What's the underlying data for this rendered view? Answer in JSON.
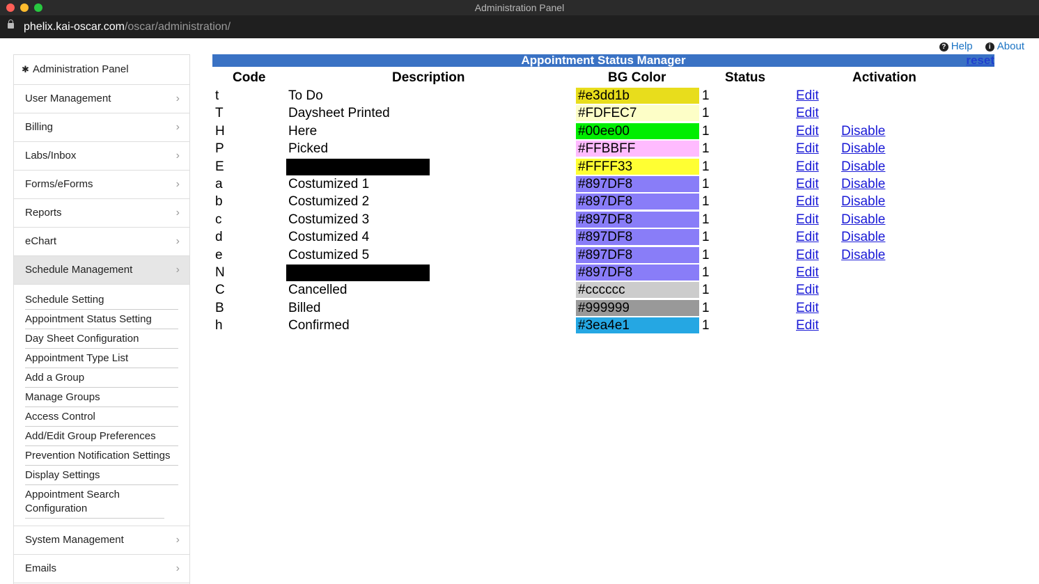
{
  "window": {
    "title": "Administration Panel"
  },
  "urlbar": {
    "host": "phelix.kai-oscar.com",
    "path": "/oscar/administration/"
  },
  "toplinks": {
    "help": "Help",
    "about": "About"
  },
  "sidebar": {
    "header": "Administration Panel",
    "sections": [
      "User Management",
      "Billing",
      "Labs/Inbox",
      "Forms/eForms",
      "Reports",
      "eChart",
      "Schedule Management"
    ],
    "submenu": [
      "Schedule Setting",
      "Appointment Status Setting",
      "Day Sheet Configuration",
      "Appointment Type List",
      "Add a Group",
      "Manage Groups",
      "Access Control",
      "Add/Edit Group Preferences",
      "Prevention Notification Settings",
      "Display Settings",
      "Appointment Search Configuration"
    ],
    "after_sections": [
      "System Management",
      "Emails"
    ]
  },
  "main": {
    "title": "Appointment Status Manager",
    "reset": "reset",
    "headers": {
      "code": "Code",
      "description": "Description",
      "bg_color": "BG Color",
      "status": "Status",
      "activation": "Activation"
    },
    "rows": [
      {
        "code": "t",
        "desc": "To Do",
        "color": "#e3dd1b",
        "swatch": "#e8dd1c",
        "status": "1",
        "edit": "Edit",
        "disable": ""
      },
      {
        "code": "T",
        "desc": "Daysheet Printed",
        "color": "#FDFEC7",
        "swatch": "#fdfec7",
        "status": "1",
        "edit": "Edit",
        "disable": ""
      },
      {
        "code": "H",
        "desc": "Here",
        "color": "#00ee00",
        "swatch": "#00ee00",
        "status": "1",
        "edit": "Edit",
        "disable": "Disable"
      },
      {
        "code": "P",
        "desc": "Picked",
        "color": "#FFBBFF",
        "swatch": "#ffbbff",
        "status": "1",
        "edit": "Edit",
        "disable": "Disable"
      },
      {
        "code": "E",
        "desc": "",
        "redacted": true,
        "color": "#FFFF33",
        "swatch": "#ffff33",
        "status": "1",
        "edit": "Edit",
        "disable": "Disable"
      },
      {
        "code": "a",
        "desc": "Costumized 1",
        "color": "#897DF8",
        "swatch": "#897df8",
        "status": "1",
        "edit": "Edit",
        "disable": "Disable"
      },
      {
        "code": "b",
        "desc": "Costumized 2",
        "color": "#897DF8",
        "swatch": "#897df8",
        "status": "1",
        "edit": "Edit",
        "disable": "Disable"
      },
      {
        "code": "c",
        "desc": "Costumized 3",
        "color": "#897DF8",
        "swatch": "#897df8",
        "status": "1",
        "edit": "Edit",
        "disable": "Disable"
      },
      {
        "code": "d",
        "desc": "Costumized 4",
        "color": "#897DF8",
        "swatch": "#897df8",
        "status": "1",
        "edit": "Edit",
        "disable": "Disable"
      },
      {
        "code": "e",
        "desc": "Costumized 5",
        "color": "#897DF8",
        "swatch": "#897df8",
        "status": "1",
        "edit": "Edit",
        "disable": "Disable"
      },
      {
        "code": "N",
        "desc": "",
        "redacted": true,
        "color": "#897DF8",
        "swatch": "#897df8",
        "status": "1",
        "edit": "Edit",
        "disable": ""
      },
      {
        "code": "C",
        "desc": "Cancelled",
        "color": "#cccccc",
        "swatch": "#cccccc",
        "status": "1",
        "edit": "Edit",
        "disable": ""
      },
      {
        "code": "B",
        "desc": "Billed",
        "color": "#999999",
        "swatch": "#999999",
        "status": "1",
        "edit": "Edit",
        "disable": ""
      },
      {
        "code": "h",
        "desc": "Confirmed",
        "color": "#3ea4e1",
        "swatch": "#25a7e3",
        "status": "1",
        "edit": "Edit",
        "disable": ""
      }
    ]
  }
}
